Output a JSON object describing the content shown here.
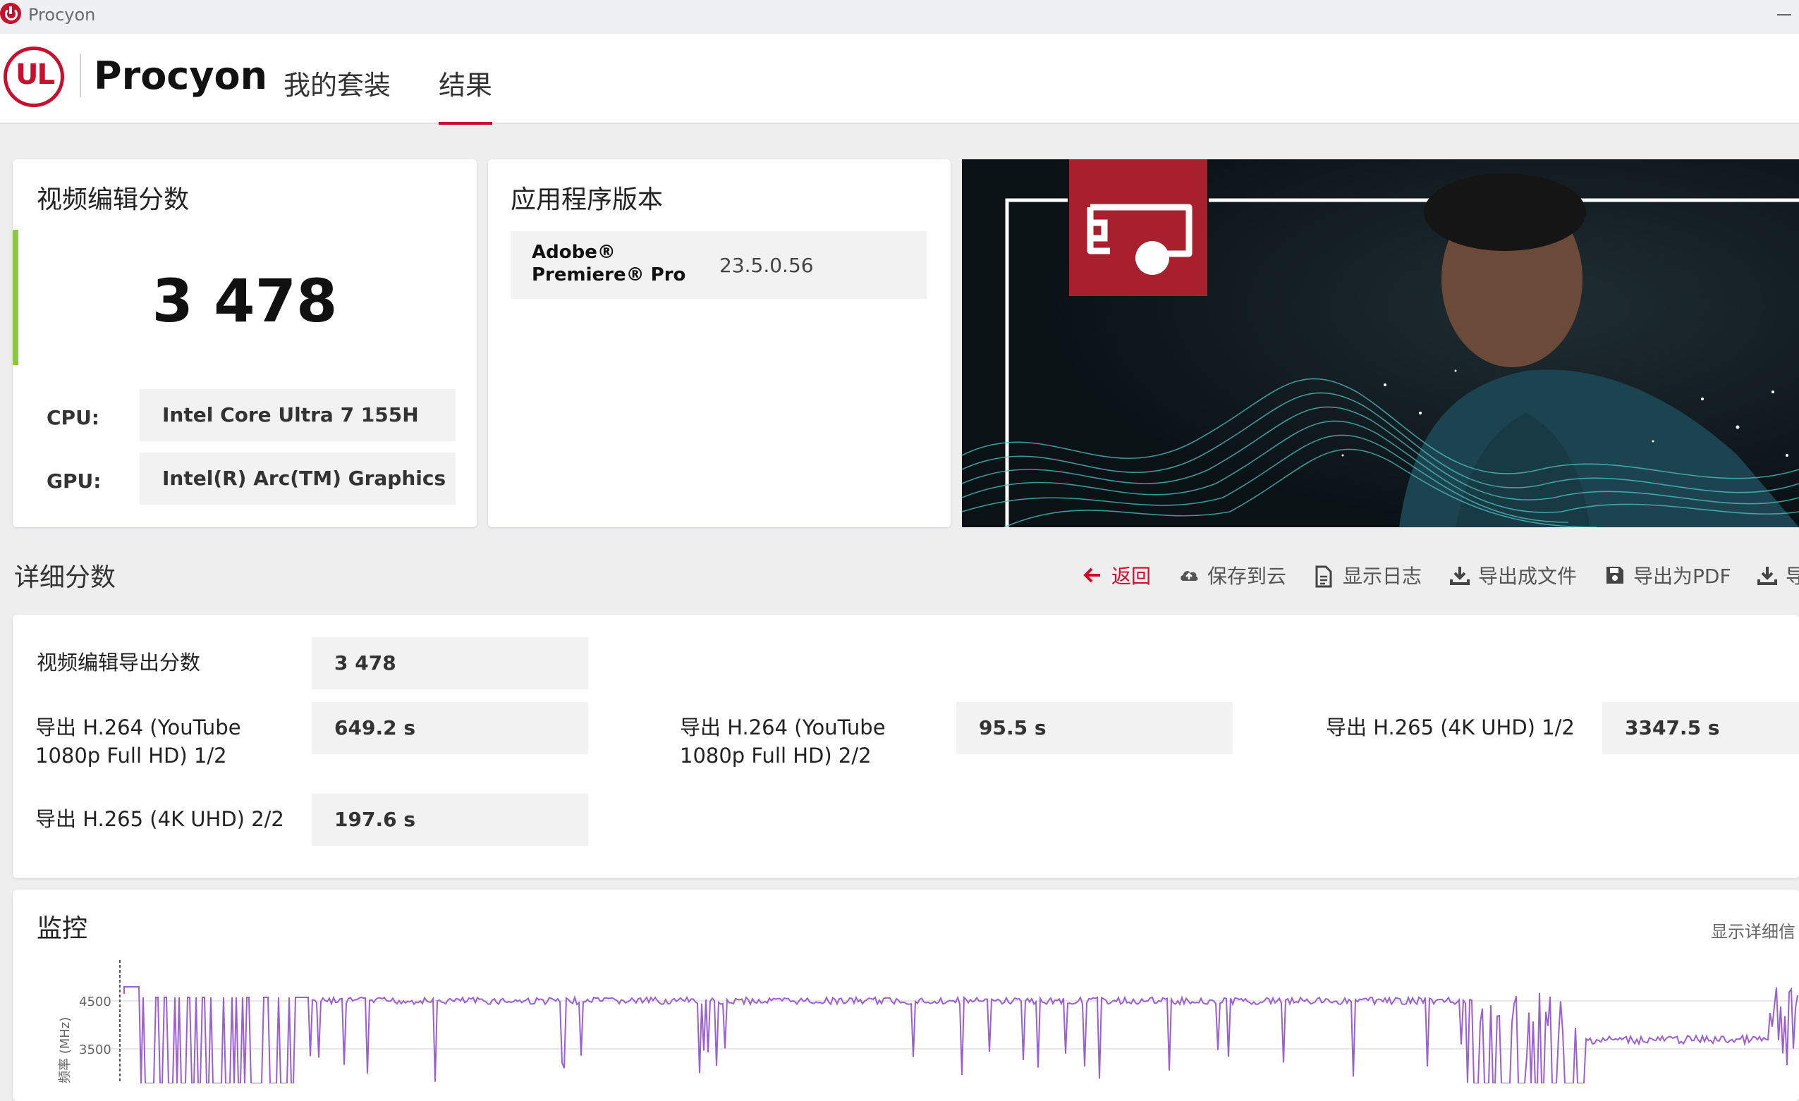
{
  "window": {
    "title": "Procyon"
  },
  "header": {
    "logo_text": "UL",
    "product_name": "Procyon",
    "tabs": [
      {
        "label": "我的套装"
      },
      {
        "label": "结果",
        "active": true
      }
    ]
  },
  "score_card": {
    "title": "视频编辑分数",
    "score": "3 478",
    "cpu_label": "CPU:",
    "cpu_value": "Intel Core Ultra 7 155H",
    "gpu_label": "GPU:",
    "gpu_value": "Intel(R) Arc(TM) Graphics",
    "accent_color": "#8dc63f"
  },
  "app_version_card": {
    "title": "应用程序版本",
    "app_name": "Adobe® Premiere® Pro",
    "version": "23.5.0.56"
  },
  "detail": {
    "title": "详细分数",
    "toolbar": {
      "back": "返回",
      "save_cloud": "保存到云",
      "show_log": "显示日志",
      "export_file": "导出成文件",
      "export_pdf": "导出为PDF",
      "export_more": "导"
    },
    "main_label": "视频编辑导出分数",
    "main_value": "3 478",
    "items": [
      {
        "label": "导出 H.264 (YouTube 1080p Full HD) 1/2",
        "value": "649.2 s"
      },
      {
        "label": "导出 H.264 (YouTube 1080p Full HD) 2/2",
        "value": "95.5 s"
      },
      {
        "label": "导出 H.265 (4K UHD) 1/2",
        "value": "3347.5 s"
      },
      {
        "label": "导出 H.265 (4K UHD) 2/2",
        "value": "197.6 s"
      }
    ]
  },
  "monitoring": {
    "title": "监控",
    "show_details": "显示详细信",
    "y_axis_label": "频率 (MHz)",
    "y_ticks": [
      "4500",
      "3500"
    ],
    "line_color": "#9a5fd0"
  },
  "colors": {
    "brand_red": "#c8102e",
    "banner_red": "#a8202e",
    "wave": "#4fc3c3"
  }
}
